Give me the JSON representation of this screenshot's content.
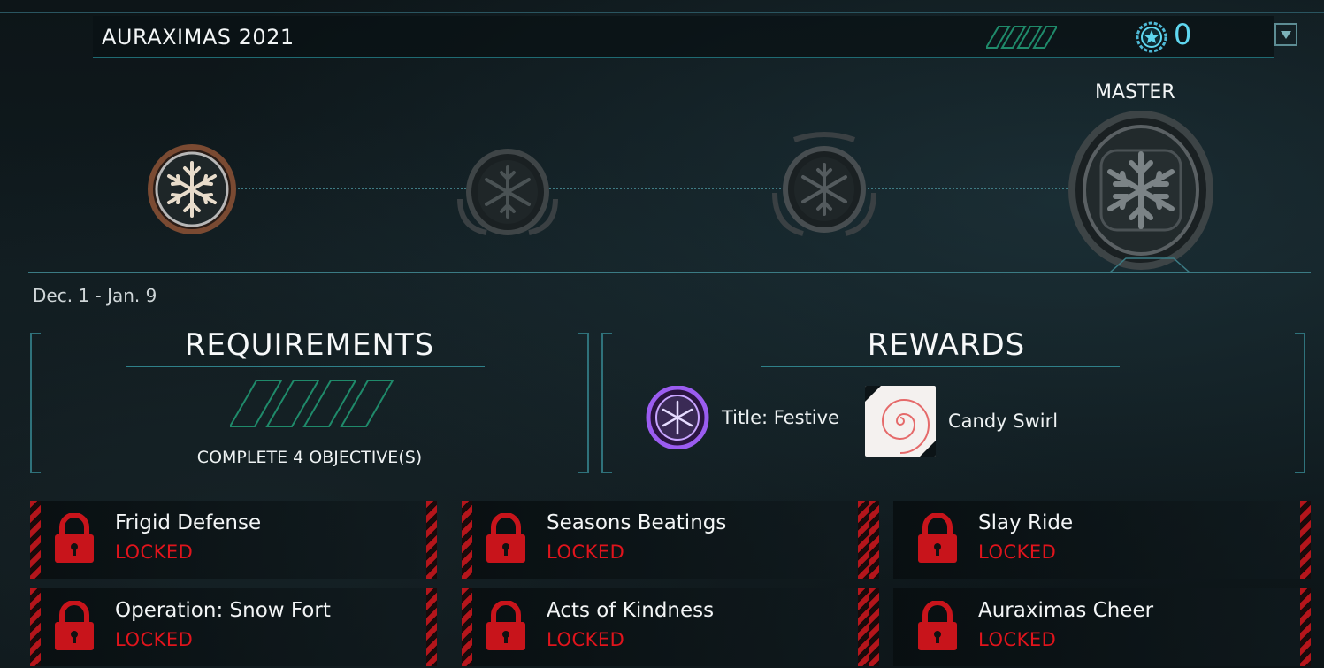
{
  "header": {
    "title": "AURAXIMAS 2021",
    "score": "0",
    "accent": "#5fd6ef"
  },
  "tiers": {
    "master_label": "MASTER",
    "icons": [
      "snowflake-badge-active",
      "snowflake-badge-locked",
      "snowflake-badge-locked",
      "snowflake-badge-master"
    ]
  },
  "dates": "Dec. 1 - Jan. 9",
  "requirements": {
    "title": "REQUIREMENTS",
    "progress_segments_total": 4,
    "progress_segments_done": 0,
    "text": "COMPLETE 4 OBJECTIVE(S)"
  },
  "rewards": {
    "title": "REWARDS",
    "items": [
      {
        "label": "Title: Festive",
        "icon": "festive-title-icon"
      },
      {
        "label": "Candy Swirl",
        "icon": "candy-swirl-icon"
      }
    ]
  },
  "objectives": [
    {
      "name": "Frigid Defense",
      "status": "LOCKED"
    },
    {
      "name": "Seasons Beatings",
      "status": "LOCKED"
    },
    {
      "name": "Slay Ride",
      "status": "LOCKED"
    },
    {
      "name": "Operation: Snow Fort",
      "status": "LOCKED"
    },
    {
      "name": "Acts of Kindness",
      "status": "LOCKED"
    },
    {
      "name": "Auraximas Cheer",
      "status": "LOCKED"
    }
  ],
  "colors": {
    "locked": "#e0141c",
    "stripe_green": "#1f8a6a",
    "line": "#2f727b"
  }
}
